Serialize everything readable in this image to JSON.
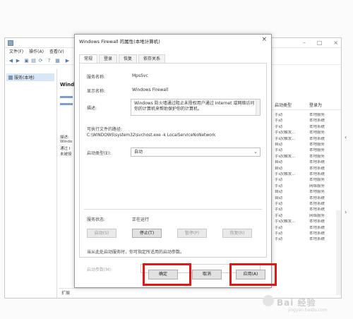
{
  "services_window": {
    "menu": [
      "文件(F)",
      "操作(A)",
      "查看(V)"
    ],
    "tree_item": "服务(本地)",
    "detail_title": "Wind",
    "detail_lines": [
      "描述:",
      "Windo",
      "通过 I",
      "未被授"
    ],
    "statusbar": "扩展",
    "list_headers": [
      "启动类型",
      "登录为"
    ],
    "list_rows": [
      [
        "手动",
        "本地服务"
      ],
      [
        "手动",
        "本地系统"
      ],
      [
        "手动",
        "本地系统"
      ],
      [
        "手动(触发...",
        "本地服务"
      ],
      [
        "手动(触发...",
        "本地系统"
      ],
      [
        "自动",
        "本地服务"
      ],
      [
        "手动",
        "本地服务"
      ],
      [
        "手动(触发...",
        "本地服务"
      ],
      [
        "自动",
        "本地系统"
      ],
      [
        "自动",
        "本地系统"
      ],
      [
        "手动(触发...",
        "本地系统"
      ],
      [
        "手动",
        "本地服务"
      ],
      [
        "手动",
        "网络服务"
      ],
      [
        "自动",
        "本地服务"
      ],
      [
        "自动",
        "本地系统"
      ],
      [
        "手动",
        "本地系统"
      ],
      [
        "手动",
        "本地系统"
      ],
      [
        "手动",
        "网络服务"
      ],
      [
        "手动(触发...",
        "本地系统"
      ],
      [
        "手动",
        "本地系统"
      ],
      [
        "手动",
        "本地系统"
      ],
      [
        "手动",
        "本地系统"
      ]
    ]
  },
  "dialog": {
    "title": "Windows Firewall 的属性(本地计算机)",
    "close_glyph": "×",
    "tabs": [
      "常规",
      "登录",
      "恢复",
      "依存关系"
    ],
    "service_name_label": "服务名称:",
    "service_name_value": "MpsSvc",
    "display_name_label": "显示名称:",
    "display_name_value": "Windows Firewall",
    "description_label": "描述:",
    "description_value": "Windows 防火墙通过阻止未授权用户通过 Internet 或网络访问你的计算机来帮助保护你的计算机。",
    "exe_path_label": "可执行文件的路径:",
    "exe_path_value": "C:\\WINDOWS\\system32\\svchost.exe -k LocalServiceNoNetwork",
    "startup_type_label": "启动类型(E):",
    "startup_type_value": "自动",
    "status_label": "服务状态:",
    "status_value": "正在运行",
    "buttons": {
      "start": "启动(S)",
      "stop": "停止(T)",
      "pause": "暂停(P)",
      "resume": "恢复(R)"
    },
    "hint_text": "当从此处启动服务时，你可指定所适用的启动参数。",
    "params_label": "启动参数(M):",
    "ok": "确定",
    "cancel": "取消",
    "apply": "应用(A)"
  },
  "watermark": {
    "brand": "Bai 经验",
    "sub": "jingyan.baidu.com"
  },
  "colors": {
    "highlight_red": "#e01818",
    "selection_blue": "#d8e7f6"
  }
}
